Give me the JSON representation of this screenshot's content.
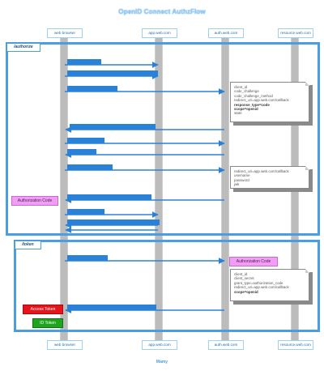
{
  "title": "OpenID Connect AuthzFlow",
  "footer": "Mamy",
  "participants": [
    "web browser",
    "app.web.com",
    "auth.web.com",
    "resource.web.com"
  ],
  "frames": {
    "authorize": "/authorize",
    "token": "/token"
  },
  "messages": [
    "",
    "",
    "",
    "",
    "",
    "",
    "",
    "",
    "",
    ""
  ],
  "notes": {
    "authorize_request": [
      "client_id",
      "code_challenge",
      "code_challenge_method",
      "redirect_uri=app.web.com/callback",
      "response_type=code",
      "scope=openid",
      "state"
    ],
    "authorize_request_bold": [
      4,
      5
    ],
    "login_request": [
      "redirect_uri=app.web.com/callback",
      "username",
      "password",
      "jwk"
    ],
    "token_request": [
      "client_id",
      "client_secret",
      "grant_type=authorization_code",
      "redirect_uri=app.web.com/callback",
      "scope=openid"
    ],
    "token_request_bold": [
      4
    ]
  },
  "tags": {
    "authorization_code_left": "Authorization Code",
    "authorization_code_right": "Authorization Code",
    "access_token": "Access Token",
    "id_token": "ID Token"
  },
  "colors": {
    "title": "#9bd6ff",
    "frame": "#4a9de0",
    "message_label": "#2a82d8",
    "authorization_code": "#f19cf5",
    "access_token": "#e8141b",
    "id_token": "#1ea51e",
    "lifeline": "#bcbcbc"
  }
}
